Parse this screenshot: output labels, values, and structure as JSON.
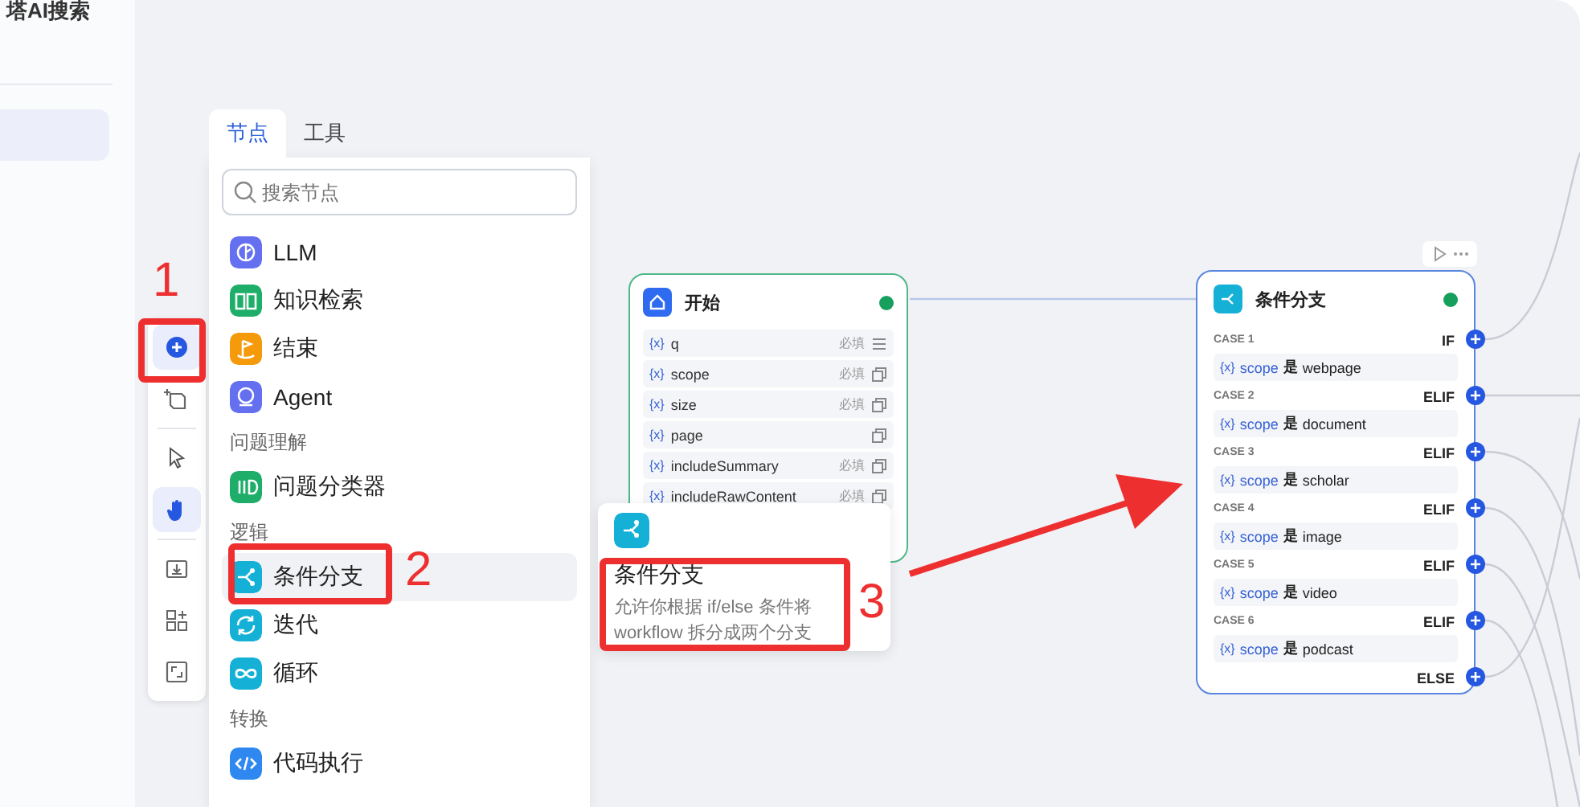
{
  "sidebar": {
    "title": "塔AI搜索"
  },
  "toolbar": {
    "tools": [
      {
        "kind": "add",
        "selected": true
      },
      {
        "kind": "note",
        "selected": false
      },
      {
        "kind": "divider"
      },
      {
        "kind": "pointer",
        "selected": false
      },
      {
        "kind": "hand",
        "selected": true
      },
      {
        "kind": "divider"
      },
      {
        "kind": "import",
        "selected": false
      },
      {
        "kind": "layout",
        "selected": false
      },
      {
        "kind": "fit",
        "selected": false
      }
    ]
  },
  "node_panel": {
    "tabs": [
      {
        "label": "节点",
        "selected": true
      },
      {
        "label": "工具",
        "selected": false
      }
    ],
    "search": {
      "placeholder": "搜索节点"
    },
    "items": [
      {
        "kind": "llm",
        "label": "LLM",
        "color": "#6470f0",
        "hovered": false
      },
      {
        "kind": "knowledge",
        "label": "知识检索",
        "color": "#1fae6a",
        "hovered": false
      },
      {
        "kind": "end",
        "label": "结束",
        "color": "#f59a0a",
        "hovered": false
      },
      {
        "kind": "agent",
        "label": "Agent",
        "color": "#6470f0",
        "hovered": false
      },
      {
        "kind": "group",
        "label": "问题理解"
      },
      {
        "kind": "classifier",
        "label": "问题分类器",
        "color": "#1fae6a",
        "hovered": false
      },
      {
        "kind": "group",
        "label": "逻辑"
      },
      {
        "kind": "condition",
        "label": "条件分支",
        "color": "#14b0d6",
        "hovered": true
      },
      {
        "kind": "iteration",
        "label": "迭代",
        "color": "#14b0d6",
        "hovered": false
      },
      {
        "kind": "loop",
        "label": "循环",
        "color": "#14b0d6",
        "hovered": false
      },
      {
        "kind": "group",
        "label": "转换"
      },
      {
        "kind": "code",
        "label": "代码执行",
        "color": "#2e88f0",
        "hovered": false
      }
    ]
  },
  "tooltip": {
    "title": "条件分支",
    "description": "允许你根据 if/else 条件将 workflow 拆分成两个分支"
  },
  "start_node": {
    "title": "开始",
    "valid": true,
    "variables": [
      {
        "kind": "list",
        "token": "{x}",
        "name": "q",
        "tag": "必填"
      },
      {
        "kind": "object",
        "token": "{x}",
        "name": "scope",
        "tag": "必填"
      },
      {
        "kind": "object",
        "token": "{x}",
        "name": "size",
        "tag": "必填"
      },
      {
        "kind": "object",
        "token": "{x}",
        "name": "page"
      },
      {
        "kind": "object",
        "token": "{x}",
        "name": "includeSummary",
        "tag": "必填"
      },
      {
        "kind": "object",
        "token": "{x}",
        "name": "includeRawContent",
        "tag": "必填"
      }
    ]
  },
  "condition_node": {
    "title": "条件分支",
    "valid": true,
    "cases": [
      {
        "label": "CASE 1",
        "branch": "IF",
        "token": "{x}",
        "variable": "scope",
        "operator": "是",
        "value": "webpage"
      },
      {
        "label": "CASE 2",
        "branch": "ELIF",
        "token": "{x}",
        "variable": "scope",
        "operator": "是",
        "value": "document"
      },
      {
        "label": "CASE 3",
        "branch": "ELIF",
        "token": "{x}",
        "variable": "scope",
        "operator": "是",
        "value": "scholar"
      },
      {
        "label": "CASE 4",
        "branch": "ELIF",
        "token": "{x}",
        "variable": "scope",
        "operator": "是",
        "value": "image"
      },
      {
        "label": "CASE 5",
        "branch": "ELIF",
        "token": "{x}",
        "variable": "scope",
        "operator": "是",
        "value": "video"
      },
      {
        "label": "CASE 6",
        "branch": "ELIF",
        "token": "{x}",
        "variable": "scope",
        "operator": "是",
        "value": "podcast"
      }
    ],
    "else_label": "ELSE"
  },
  "annotations": [
    {
      "number": "1"
    },
    {
      "number": "2"
    },
    {
      "number": "3"
    }
  ]
}
